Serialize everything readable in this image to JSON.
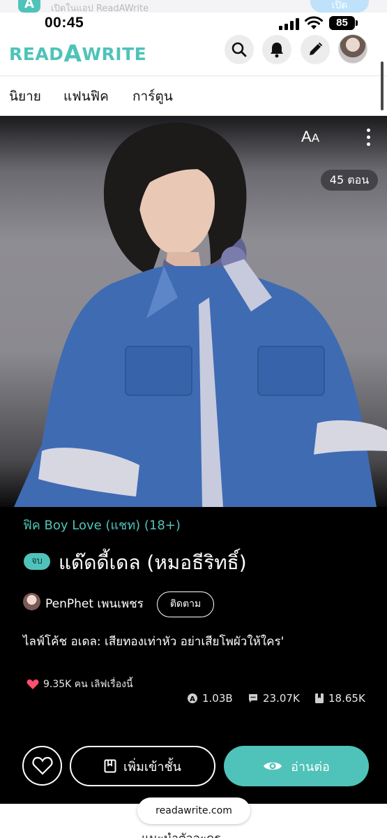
{
  "app_banner": {
    "text": "เปิดในแอป ReadAWrite",
    "open_label": "เปิด",
    "icon_letter": "A"
  },
  "status_bar": {
    "time": "00:45",
    "battery": "85"
  },
  "header": {
    "logo_pre": "READ",
    "logo_a": "A",
    "logo_post": "WRITE",
    "brand_color": "#4fc3b9",
    "icons": [
      "search-icon",
      "bell-icon",
      "pencil-icon",
      "avatar"
    ]
  },
  "tabs": [
    {
      "label": "นิยาย"
    },
    {
      "label": "แฟนฟิค"
    },
    {
      "label": "การ์ตูน"
    }
  ],
  "cover": {
    "font_button": "A",
    "font_button_small": "A",
    "episode_count": "45 ตอน"
  },
  "story": {
    "genre": "ฟิค Boy Love (แชท) (18+)",
    "status_badge": "จบ",
    "title": "แด๊ดดี้เดล (หมอธีริทธิ์)",
    "author": "PenPhet เพนเพชร",
    "follow_label": "ติดตาม",
    "description": "ไลฟ์โค้ช อเดล: เสียทองเท่าหัว อย่าเสียโพผัวให้ใคร'",
    "likes": "9.35K คน เลิฟเรื่องนี้",
    "stats": [
      {
        "icon": "views-icon",
        "value": "1.03B"
      },
      {
        "icon": "comment-icon",
        "value": "23.07K"
      },
      {
        "icon": "bookmark-icon",
        "value": "18.65K"
      }
    ]
  },
  "actions": {
    "add_shelf_label": "เพิ่มเข้าชั้น",
    "read_label": "อ่านต่อ"
  },
  "bottom": {
    "url": "readawrite.com",
    "next_heading": "แนะนำตัวละคร"
  },
  "colors": {
    "accent": "#4fc3b9",
    "like": "#ff4d6d",
    "panel": "#000000"
  }
}
